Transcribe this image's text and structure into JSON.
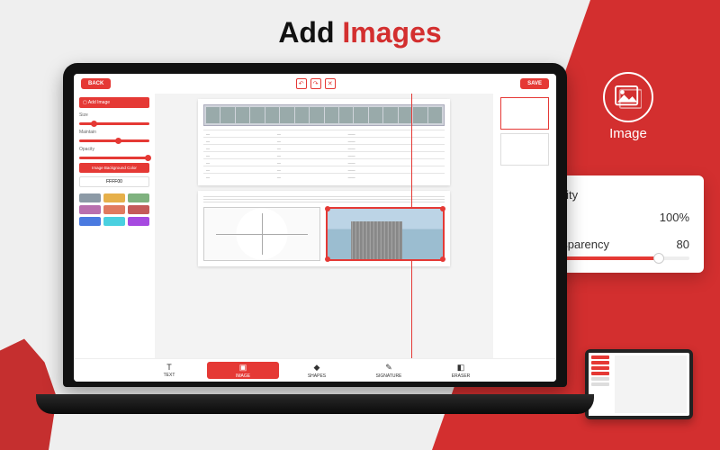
{
  "headline": {
    "prefix": "Add ",
    "accent": "Images"
  },
  "callout": {
    "label": "Image"
  },
  "panel": {
    "opacity_label": "Opacity",
    "opacity_value": "100%",
    "transparency_label": "Transparency",
    "transparency_value": "80"
  },
  "app": {
    "back": "BACK",
    "save": "SAVE",
    "sidebar": {
      "add_image": "Add Image",
      "size": "Size",
      "maintain": "Maintain",
      "opacity": "Opacity",
      "bg_color": "Image Background Color",
      "hex": "FFFF00"
    },
    "swatches": [
      "#8c9aa6",
      "#e6b04a",
      "#7fb27f",
      "#b96fae",
      "#e07a5f",
      "#c45a5a",
      "#4a7ae0",
      "#4ad0e0",
      "#a64ae0"
    ],
    "tools": {
      "text": "TEXT",
      "image": "IMAGE",
      "shapes": "SHAPES",
      "signature": "SIGNATURE",
      "eraser": "ERASER"
    }
  }
}
